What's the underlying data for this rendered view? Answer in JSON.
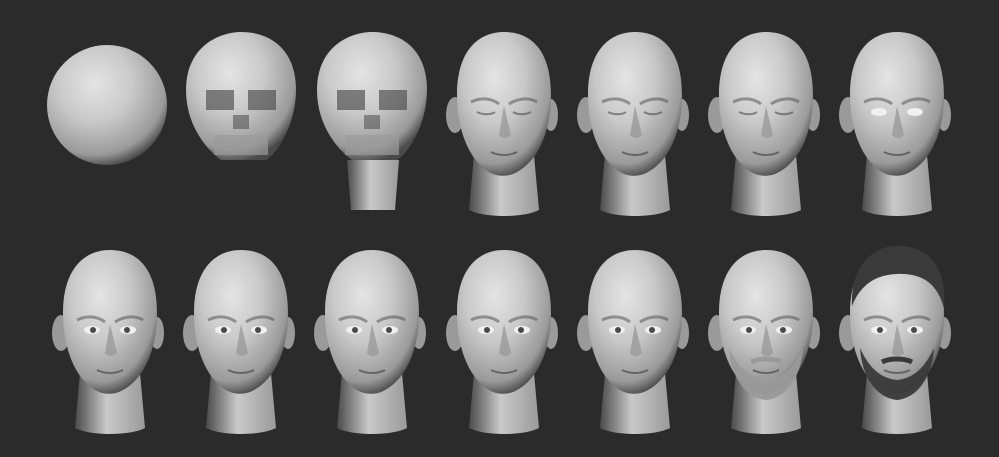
{
  "scene": {
    "background_color": "#2b2b2b",
    "clay_light": "#c9c9c9",
    "clay_mid": "#9a9a9a",
    "clay_dark": "#4a4a4a",
    "hair_color": "#3a3a3a"
  },
  "progression": {
    "rows": [
      {
        "stages": [
          {
            "name": "sphere"
          },
          {
            "name": "blocky-skull"
          },
          {
            "name": "skull-with-neck"
          },
          {
            "name": "rough-face-eyes-closed"
          },
          {
            "name": "refined-face-eyes-closed"
          },
          {
            "name": "smooth-face-eyes-closed"
          },
          {
            "name": "face-eyes-open"
          }
        ]
      },
      {
        "stages": [
          {
            "name": "detailed-head"
          },
          {
            "name": "detailed-head-refined"
          },
          {
            "name": "detailed-head-expression"
          },
          {
            "name": "detailed-head-textured"
          },
          {
            "name": "detailed-head-final-skin"
          },
          {
            "name": "bearded-head-sculpted"
          },
          {
            "name": "bearded-head-with-hair"
          }
        ]
      }
    ]
  }
}
